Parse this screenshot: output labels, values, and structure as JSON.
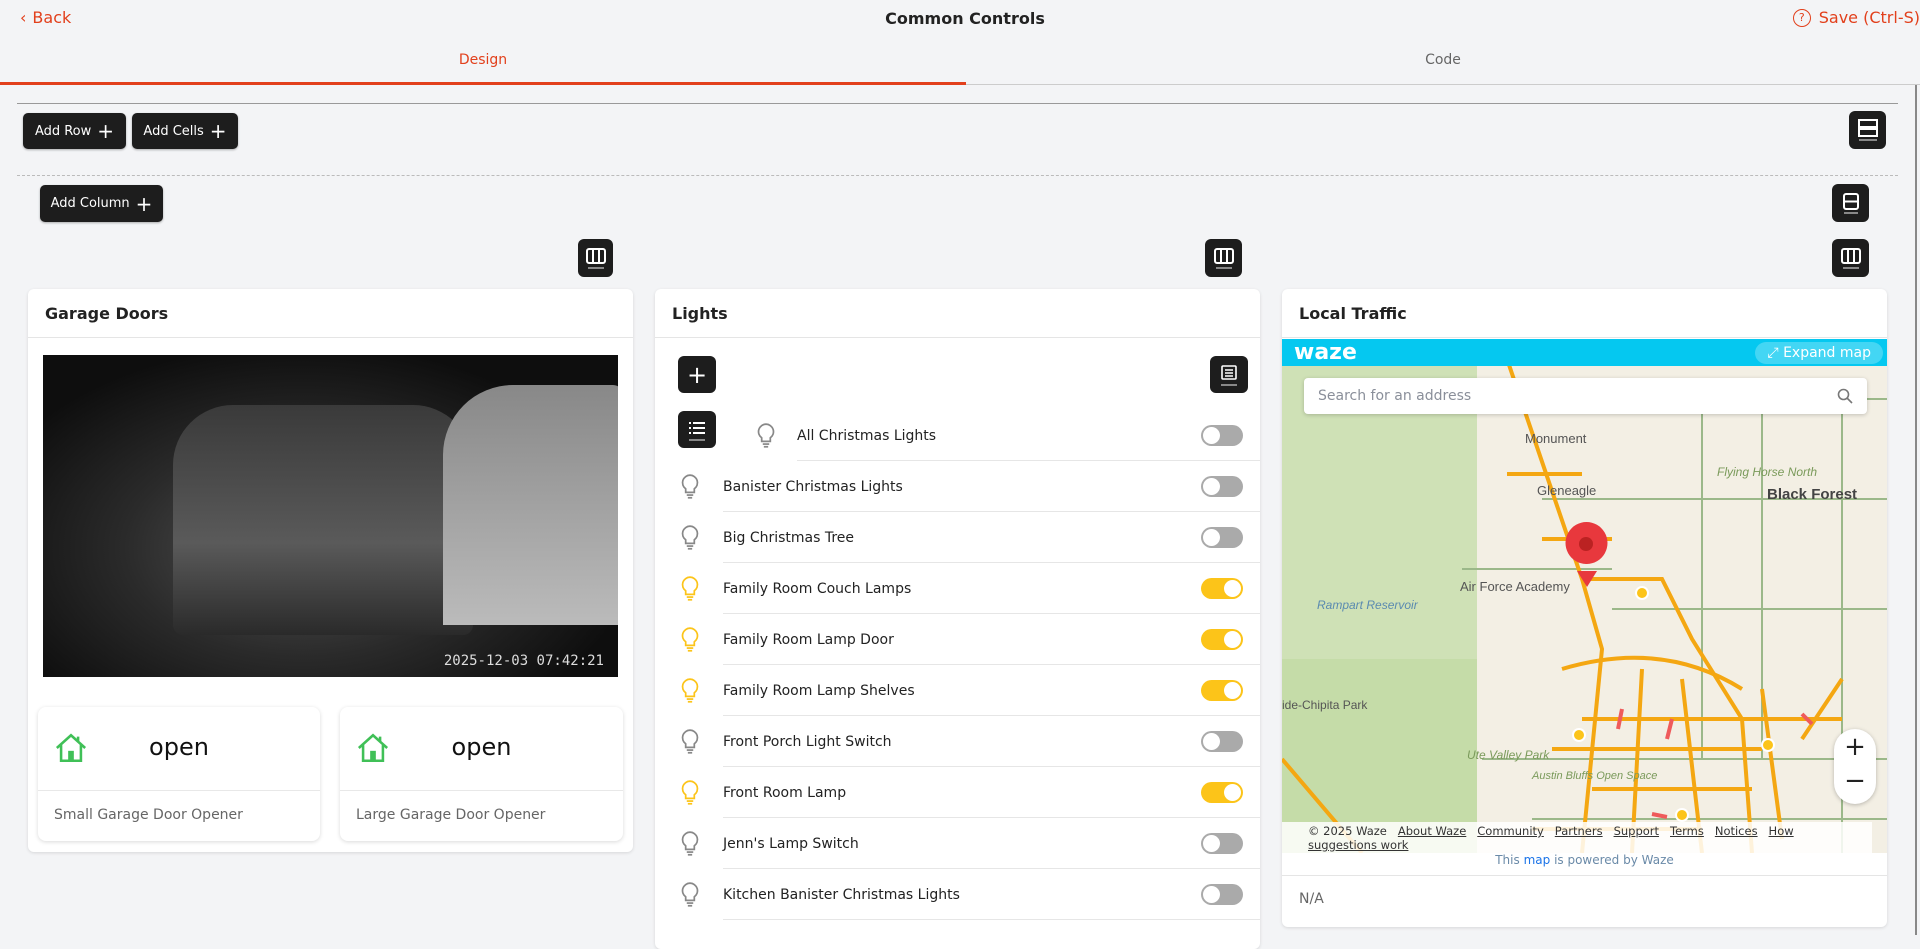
{
  "header": {
    "back": "Back",
    "title": "Common Controls",
    "save": "Save (Ctrl-S)"
  },
  "tabs": [
    {
      "label": "Design",
      "active": true
    },
    {
      "label": "Code",
      "active": false
    }
  ],
  "toolbar": {
    "add_row": "Add Row",
    "add_cells": "Add Cells",
    "add_column": "Add Column"
  },
  "garage": {
    "title": "Garage Doors",
    "timestamp": "2025-12-03  07:42:21",
    "doors": [
      {
        "state": "open",
        "label": "Small Garage Door Opener"
      },
      {
        "state": "open",
        "label": "Large Garage Door Opener"
      }
    ]
  },
  "lights": {
    "title": "Lights",
    "items": [
      {
        "name": "All Christmas Lights",
        "on": false
      },
      {
        "name": "Banister Christmas Lights",
        "on": false
      },
      {
        "name": "Big Christmas Tree",
        "on": false
      },
      {
        "name": "Family Room Couch Lamps",
        "on": true
      },
      {
        "name": "Family Room Lamp Door",
        "on": true
      },
      {
        "name": "Family Room Lamp Shelves",
        "on": true
      },
      {
        "name": "Front Porch Light Switch",
        "on": false
      },
      {
        "name": "Front Room Lamp",
        "on": true
      },
      {
        "name": "Jenn's Lamp Switch",
        "on": false
      },
      {
        "name": "Kitchen Banister Christmas Lights",
        "on": false
      }
    ]
  },
  "traffic": {
    "title": "Local Traffic",
    "brand": "waze",
    "expand": "Expand map",
    "search_placeholder": "Search for an address",
    "places": [
      "Monument",
      "Gleneagle",
      "Flying Horse North",
      "Black Forest",
      "Air Force Academy",
      "Rampart Reservoir",
      "ide-Chipita Park",
      "Ute Valley Park",
      "Austin Bluffs Open Space"
    ],
    "footer_links": [
      "© 2025 Waze",
      "About Waze",
      "Community",
      "Partners",
      "Support",
      "Terms",
      "Notices",
      "How suggestions work"
    ],
    "powered": [
      "This",
      "map",
      "is powered by Waze"
    ],
    "status": "N/A"
  },
  "colors": {
    "accent": "#e2401c",
    "on": "#fcc419",
    "off": "#aaaaaa",
    "waze": "#05c8f0",
    "door": "#40c057"
  }
}
